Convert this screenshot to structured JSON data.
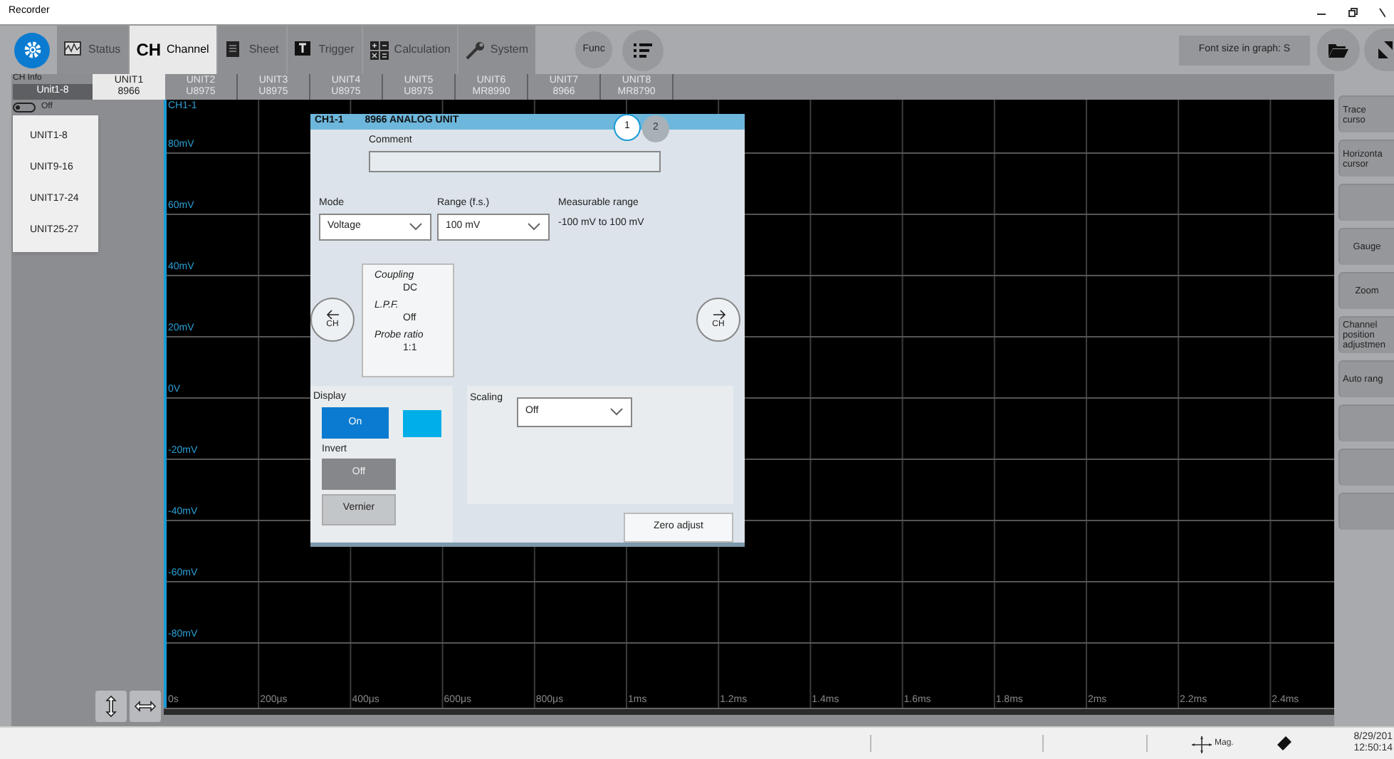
{
  "window": {
    "title": "Recorder"
  },
  "toolbar": {
    "tabs": [
      {
        "kind": "waveform",
        "label": "Status",
        "selected": false
      },
      {
        "kind": "ch",
        "icon_text": "CH",
        "label": "Channel",
        "selected": true
      },
      {
        "kind": "sheet",
        "label": "Sheet",
        "selected": false
      },
      {
        "kind": "trigger",
        "label": "Trigger",
        "selected": false
      },
      {
        "kind": "calculation",
        "label": "Calculation",
        "selected": false
      },
      {
        "kind": "wrench",
        "label": "System",
        "selected": false
      }
    ],
    "func_button": "Func",
    "font_size_button": "Font size in graph: S"
  },
  "ch_info": {
    "label": "CH Info",
    "unit_select": {
      "value": "Unit1-8",
      "expanded": true,
      "options": [
        "UNIT1-8",
        "UNIT9-16",
        "UNIT17-24",
        "UNIT25-27"
      ]
    },
    "toggle": {
      "on": false,
      "label": "Off"
    }
  },
  "unit_tabs": [
    {
      "name": "UNIT1",
      "model": "8966",
      "selected": true
    },
    {
      "name": "UNIT2",
      "model": "U8975",
      "selected": false
    },
    {
      "name": "UNIT3",
      "model": "U8975",
      "selected": false
    },
    {
      "name": "UNIT4",
      "model": "U8975",
      "selected": false
    },
    {
      "name": "UNIT5",
      "model": "U8975",
      "selected": false
    },
    {
      "name": "UNIT6",
      "model": "MR8990",
      "selected": false
    },
    {
      "name": "UNIT7",
      "model": "8966",
      "selected": false
    },
    {
      "name": "UNIT8",
      "model": "MR8790",
      "selected": false
    }
  ],
  "graph": {
    "channel": "CH1-1",
    "y_ticks": [
      "80mV",
      "60mV",
      "40mV",
      "20mV",
      "0V",
      "-20mV",
      "-40mV",
      "-60mV",
      "-80mV"
    ],
    "x_ticks": [
      "0s",
      "200μs",
      "400μs",
      "600μs",
      "800μs",
      "1ms",
      "1.2ms",
      "1.4ms",
      "1.6ms",
      "1.8ms",
      "2ms",
      "2.2ms",
      "2.4ms"
    ]
  },
  "dialog": {
    "channel": "CH1-1",
    "title": "8966 ANALOG UNIT",
    "pages": [
      {
        "label": "1",
        "selected": true
      },
      {
        "label": "2",
        "selected": false
      }
    ],
    "comment": {
      "label": "Comment"
    },
    "mode": {
      "label": "Mode",
      "value": "Voltage"
    },
    "range": {
      "label": "Range (f.s.)",
      "value": "100 mV"
    },
    "measurable": {
      "label": "Measurable range",
      "value": "-100 mV to 100 mV"
    },
    "prev_button": "CH",
    "next_button": "CH",
    "info": [
      {
        "label": "Coupling",
        "value": "DC"
      },
      {
        "label": "L.P.F.",
        "value": "Off"
      },
      {
        "label": "Probe ratio",
        "value": "1:1"
      }
    ],
    "display": {
      "label": "Display",
      "button": {
        "label": "On",
        "on": true
      },
      "color": "#00aee8"
    },
    "invert": {
      "label": "Invert",
      "button": {
        "label": "Off",
        "on": false
      }
    },
    "vernier_button": "Vernier",
    "scaling": {
      "label": "Scaling",
      "value": "Off"
    },
    "zero_adjust_button": "Zero adjust"
  },
  "right_panel": [
    {
      "kind": "labeled",
      "label": "Trace curso"
    },
    {
      "kind": "labeled",
      "label": "Horizonta cursor"
    },
    {
      "kind": "blank"
    },
    {
      "kind": "labeled",
      "label": "Gauge"
    },
    {
      "kind": "labeled",
      "label": "Zoom"
    },
    {
      "kind": "labeled",
      "label": "Channel position adjustmen"
    },
    {
      "kind": "labeled",
      "label": "Auto rang"
    },
    {
      "kind": "blank"
    },
    {
      "kind": "blank"
    },
    {
      "kind": "blank"
    }
  ],
  "status_bar": {
    "mag_label": "Mag.",
    "date": "8/29/201",
    "time": "12:50:14"
  }
}
